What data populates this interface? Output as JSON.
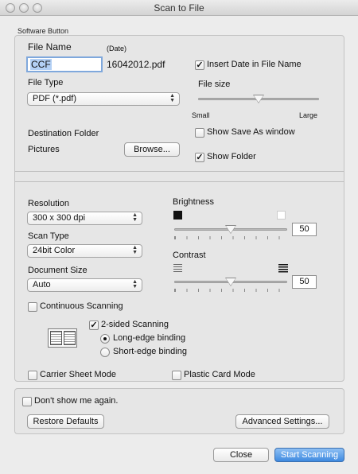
{
  "window": {
    "title": "Scan to File"
  },
  "group": {
    "label": "Software Button"
  },
  "file": {
    "name_label": "File Name",
    "date_label": "(Date)",
    "name_value": "CCF",
    "filename_suffix": "16042012.pdf",
    "insert_date_label": "Insert Date in File Name",
    "insert_date_checked": true,
    "type_label": "File Type",
    "type_value": "PDF (*.pdf)",
    "size_label": "File size",
    "size_small": "Small",
    "size_large": "Large",
    "size_level": 0.5,
    "dest_label": "Destination Folder",
    "dest_value": "Pictures",
    "browse_label": "Browse...",
    "show_save_as_label": "Show Save As window",
    "show_save_as_checked": false,
    "show_folder_label": "Show Folder",
    "show_folder_checked": true
  },
  "scan": {
    "resolution_label": "Resolution",
    "resolution_value": "300 x 300 dpi",
    "type_label": "Scan Type",
    "type_value": "24bit Color",
    "doc_size_label": "Document Size",
    "doc_size_value": "Auto",
    "brightness_label": "Brightness",
    "brightness_value": "50",
    "contrast_label": "Contrast",
    "contrast_value": "50",
    "continuous_label": "Continuous Scanning",
    "continuous_checked": false,
    "two_sided_label": "2-sided Scanning",
    "two_sided_checked": true,
    "long_edge_label": "Long-edge binding",
    "long_edge_selected": true,
    "short_edge_label": "Short-edge binding",
    "carrier_label": "Carrier Sheet Mode",
    "plastic_label": "Plastic Card Mode"
  },
  "footer": {
    "dont_show_label": "Don't show me again.",
    "restore_label": "Restore Defaults",
    "advanced_label": "Advanced Settings..."
  },
  "actions": {
    "close_label": "Close",
    "start_label": "Start Scanning"
  }
}
